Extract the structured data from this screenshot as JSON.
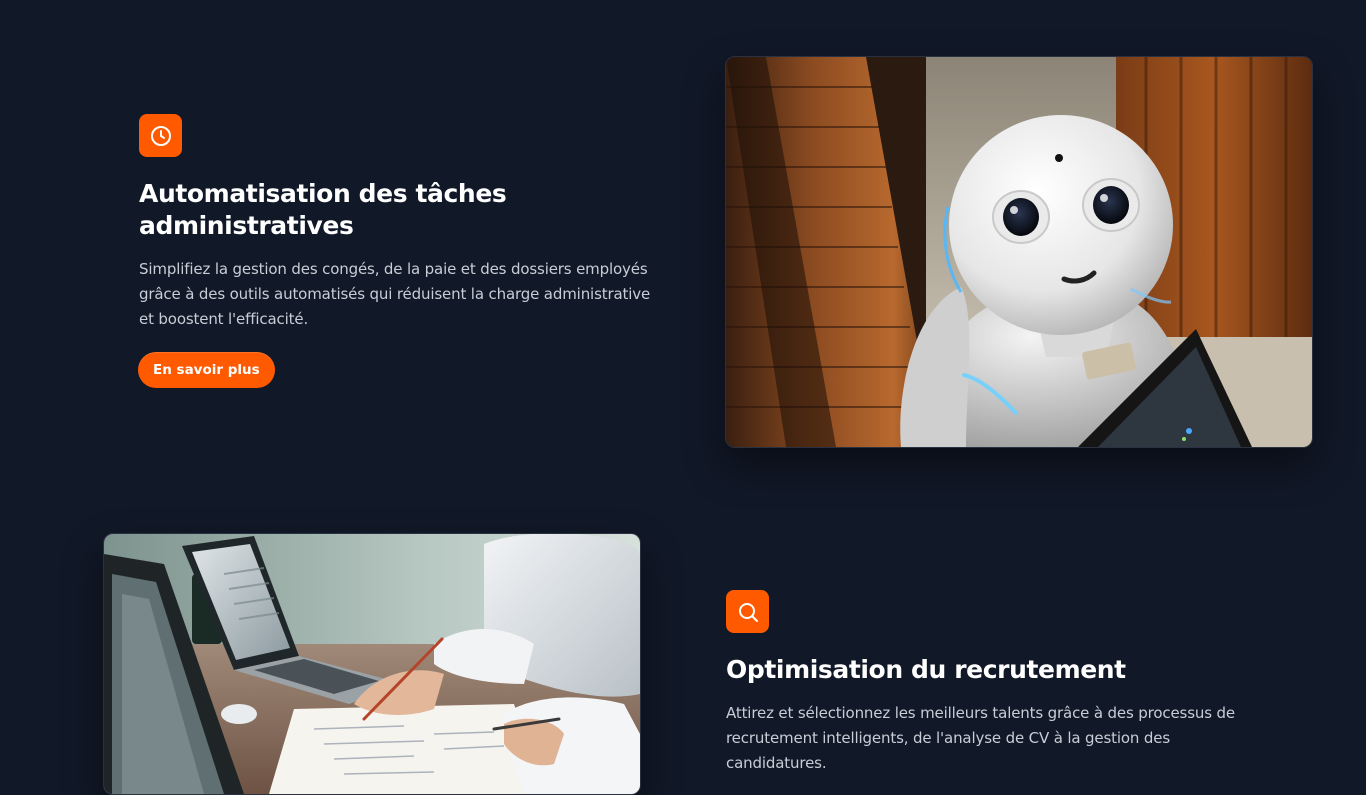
{
  "colors": {
    "background": "#111827",
    "accent": "#ff5a00",
    "text_primary": "#ffffff",
    "text_secondary": "#c8cdd6"
  },
  "features": [
    {
      "icon": "clock-icon",
      "title_line1": "Automatisation des tâches",
      "title_line2": "administratives",
      "desc_line1": "Simplifiez la gestion des congés, de la paie et des dossiers employés",
      "desc_line2": "grâce à des outils automatisés qui réduisent la charge administrative",
      "desc_line3": "et boostent l'efficacité.",
      "cta_label": "En savoir plus",
      "image": "robot-photo"
    },
    {
      "icon": "search-icon",
      "title_line1": "Optimisation du recrutement",
      "desc_line1": "Attirez et sélectionnez les meilleurs talents grâce à des processus de",
      "desc_line2": "recrutement intelligents, de l'analyse de CV à la gestion des",
      "desc_line3": "candidatures.",
      "image": "laptop-meeting-photo"
    }
  ]
}
